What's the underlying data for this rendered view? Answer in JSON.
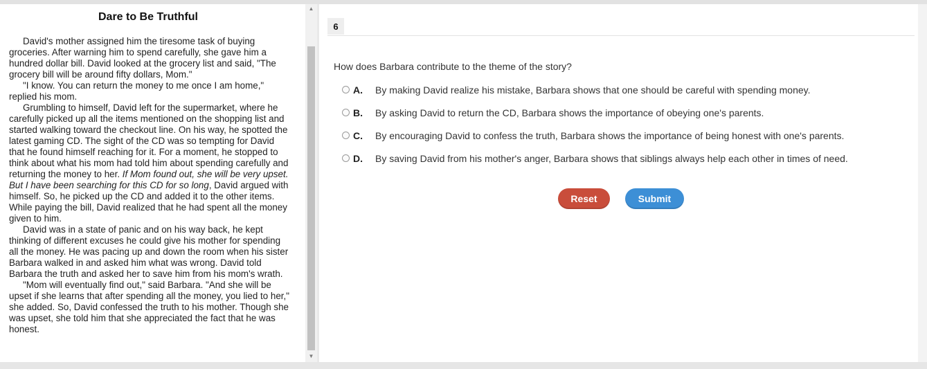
{
  "passage": {
    "title": "Dare to Be Truthful",
    "p1": "David's mother assigned him the tiresome task of buying groceries. After warning him to spend carefully, she gave him a hundred dollar bill. David looked at the grocery list and said, \"The grocery bill will be around fifty dollars, Mom.\"",
    "p2": "\"I know. You can return the money to me once I am home,\" replied his mom.",
    "p3_a": "Grumbling to himself, David left for the supermarket, where he carefully picked up all the items mentioned on the shopping list and started walking toward the checkout line. On his way, he spotted the latest gaming CD. The sight of the CD was so tempting for David that he found himself reaching for it. For a moment, he stopped to think about what his mom had told him about spending carefully and returning the money to her. ",
    "p3_italic": "If Mom found out, she will be very upset. But I have been searching for this CD for so long",
    "p3_b": ", David argued with himself. So, he picked up the CD and added it to the other items. While paying the bill, David realized that he had spent all the money given to him.",
    "p4": "David was in a state of panic and on his way back, he kept thinking of different excuses he could give his mother for spending all the money. He was pacing up and down the room when his sister Barbara walked in and asked him what was wrong. David told Barbara the truth and asked her to save him from his mom's wrath.",
    "p5": "\"Mom will eventually find out,\" said Barbara. \"And she will be upset if she learns that after spending all the money, you lied to her,\" she added. So, David confessed the truth to his mother. Though she was upset, she told him that she appreciated the fact that he was honest."
  },
  "question_number": "6",
  "question_text": "How does Barbara contribute to the theme of the story?",
  "options": [
    {
      "letter": "A.",
      "text": "By making David realize his mistake, Barbara shows that one should be careful with spending money."
    },
    {
      "letter": "B.",
      "text": "By asking David to return the CD, Barbara shows the importance of obeying one's parents."
    },
    {
      "letter": "C.",
      "text": "By encouraging David to confess the truth, Barbara shows the importance of being honest with one's parents."
    },
    {
      "letter": "D.",
      "text": "By saving David from his mother's anger, Barbara shows that siblings always help each other in times of need."
    }
  ],
  "buttons": {
    "reset": "Reset",
    "submit": "Submit"
  },
  "colors": {
    "reset": "#c94d3b",
    "submit": "#3d8fd6"
  }
}
